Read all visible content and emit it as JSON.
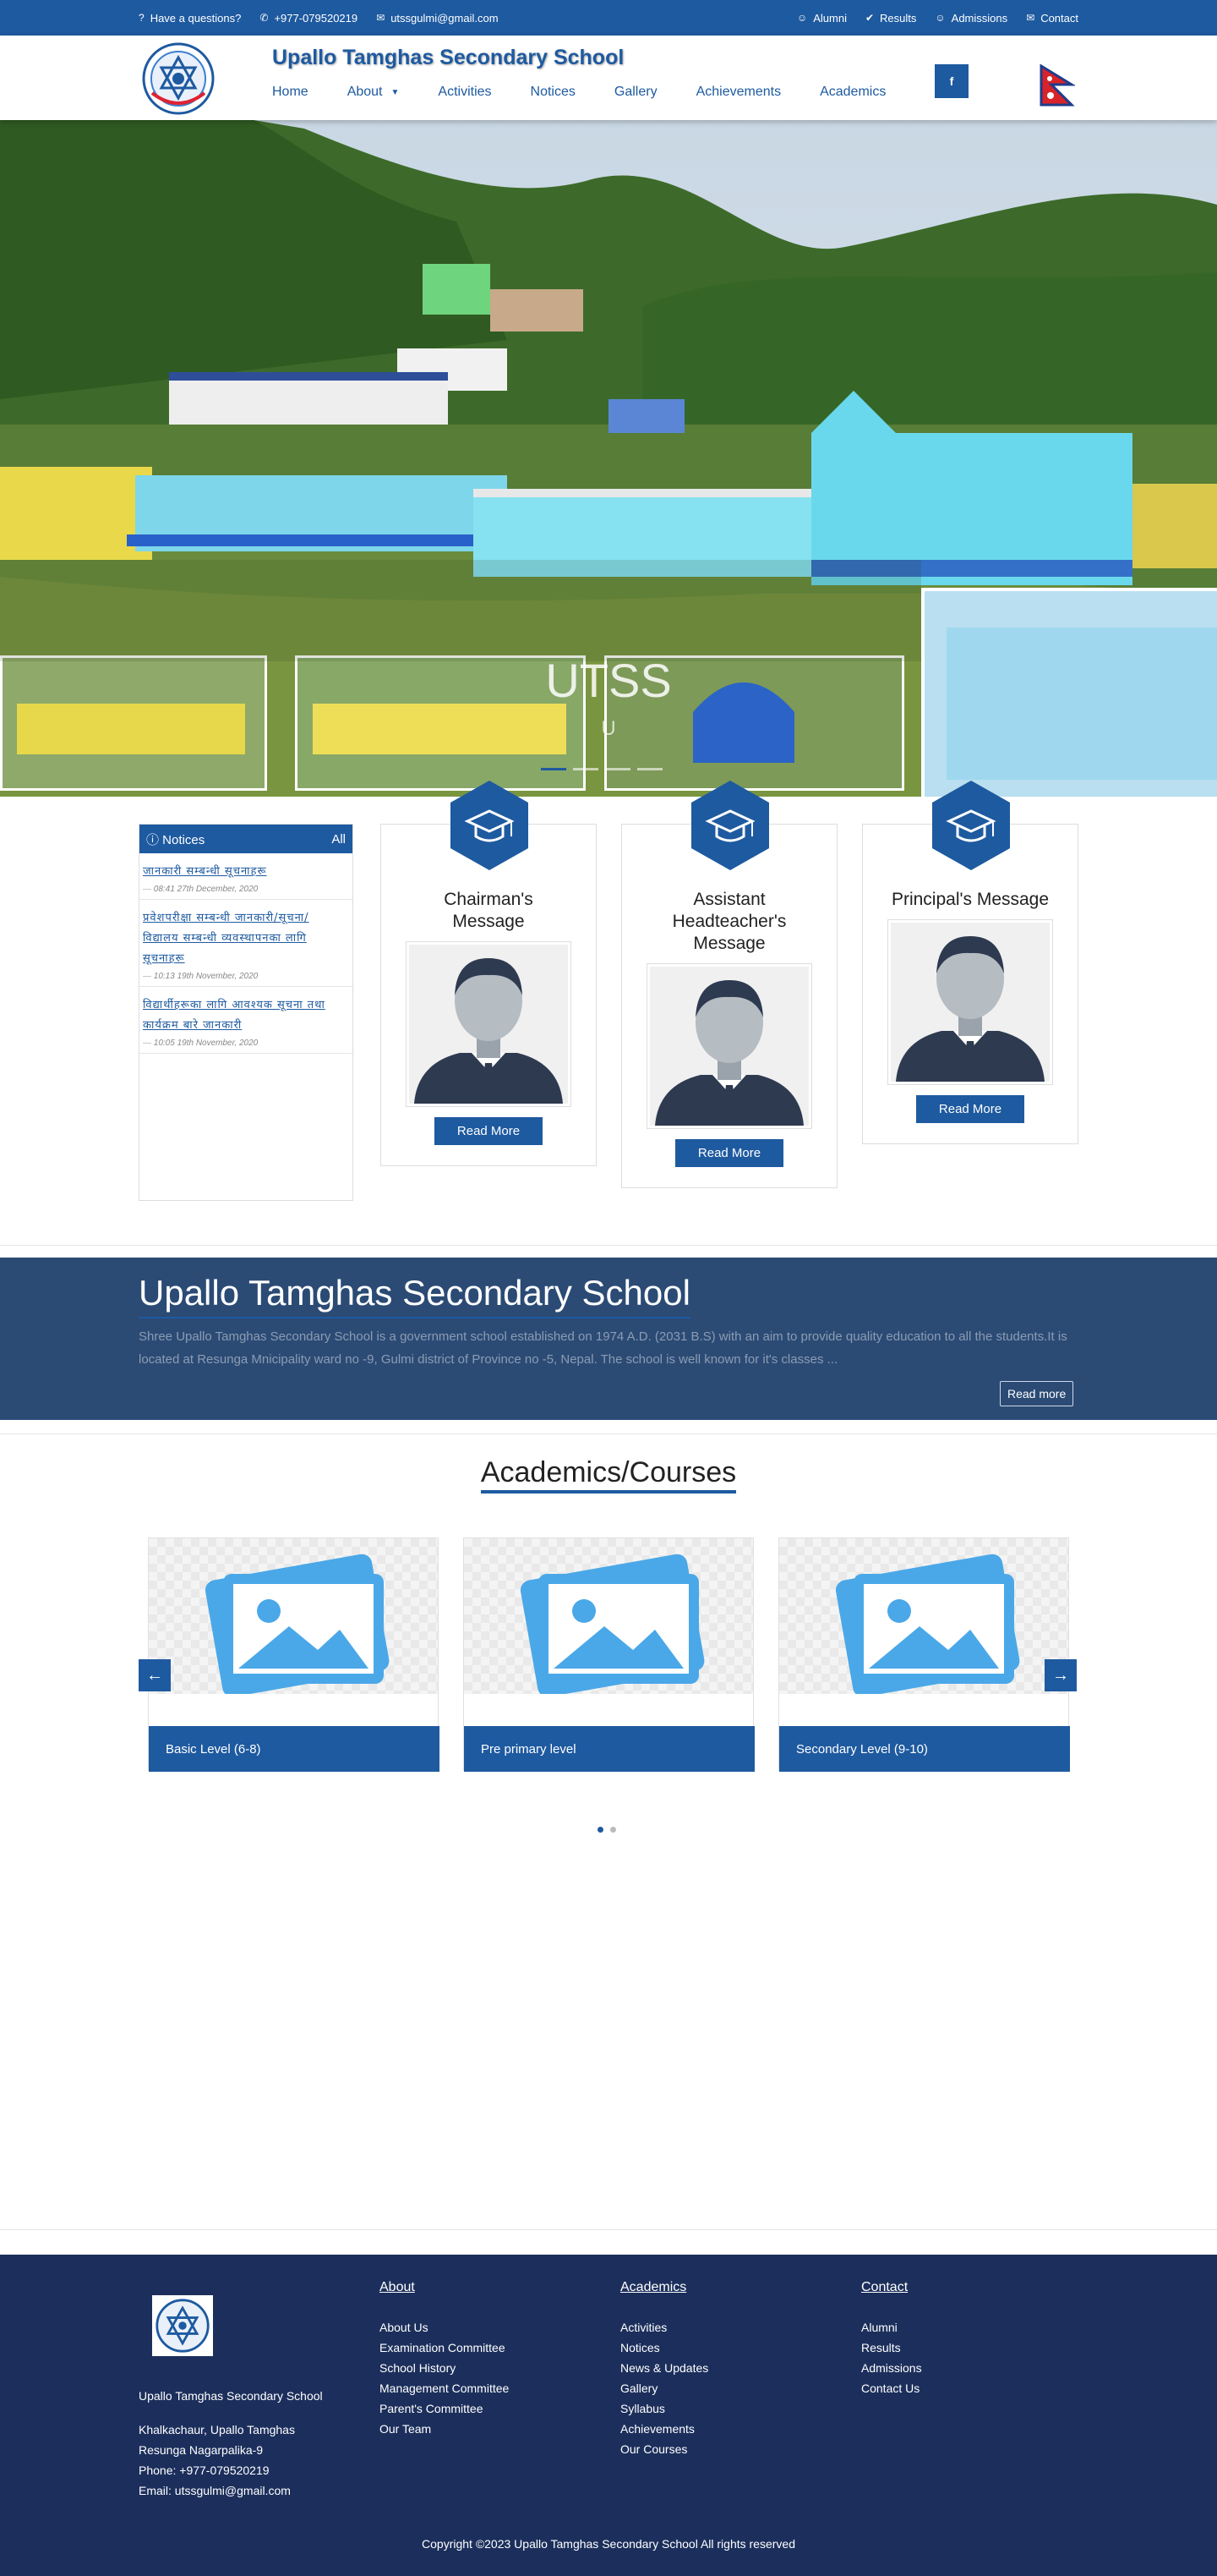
{
  "topbar": {
    "question": "Have a questions?",
    "phone": "+977-079520219",
    "email": "utssgulmi@gmail.com",
    "links": [
      "Alumni",
      "Results",
      "Admissions",
      "Contact"
    ]
  },
  "header": {
    "school_name": "Upallo Tamghas Secondary School",
    "nav": [
      "Home",
      "About",
      "Activities",
      "Notices",
      "Gallery",
      "Achievements",
      "Academics"
    ],
    "facebook": "f"
  },
  "hero": {
    "title": "UTSS",
    "subtitle": "U"
  },
  "notices": {
    "heading": "Notices",
    "all": "All",
    "items": [
      {
        "title": "जानकारी सम्बन्धी सूचनाहरू",
        "date": "08:41 27th December, 2020"
      },
      {
        "title": "प्रवेशपरीक्षा सम्बन्धी जानकारी/सूचना/ विद्यालय सम्बन्धी व्यवस्थापनका लागि सूचनाहरू",
        "date": "10:13 19th November, 2020"
      },
      {
        "title": "विद्यार्थीहरूका लागि आवश्यक सूचना तथा कार्यक्रम बारे जानकारी",
        "date": "10:05 19th November, 2020"
      }
    ]
  },
  "messages": [
    {
      "title": "Chairman's Message",
      "button": "Read More"
    },
    {
      "title": "Assistant Headteacher's Message",
      "button": "Read More"
    },
    {
      "title": "Principal's Message",
      "button": "Read More"
    }
  ],
  "about": {
    "title": "Upallo Tamghas Secondary School",
    "text": "Shree Upallo Tamghas Secondary School is a government school established on 1974 A.D. (2031 B.S) with an aim to provide quality education to all the students.It is located at Resunga Mnicipality ward no -9, Gulmi district of Province no -5, Nepal.  The school is well known for it's classes ...",
    "button": "Read more"
  },
  "academics": {
    "title": "Academics/Courses",
    "courses": [
      "Basic Level (6-8)",
      "Pre primary level",
      "Secondary Level (9-10)"
    ]
  },
  "footer": {
    "school": "Upallo Tamghas Secondary School",
    "address1": "Khalkachaur, Upallo Tamghas",
    "address2": "Resunga Nagarpalika-9",
    "phone": "Phone: +977-079520219",
    "email": "Email: utssgulmi@gmail.com",
    "about_heading": "About",
    "about_links": [
      "About Us",
      "Examination Committee",
      "School History",
      "Management Committee",
      "Parent's Committee",
      "Our Team"
    ],
    "academics_heading": "Academics",
    "academics_links": [
      "Activities",
      "Notices",
      "News & Updates",
      "Gallery",
      "Syllabus",
      "Achievements",
      "Our Courses"
    ],
    "contact_heading": "Contact",
    "contact_links": [
      "Alumni",
      "Results",
      "Admissions",
      "Contact Us"
    ],
    "copyright": "Copyright ©2023 Upallo Tamghas Secondary School All rights reserved"
  },
  "colors": {
    "primary": "#1e5aa0",
    "about_bg": "#2b4b75",
    "footer_bg": "#1c2f5c"
  }
}
